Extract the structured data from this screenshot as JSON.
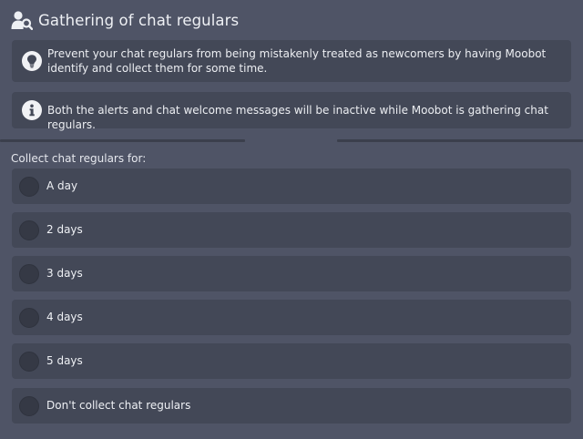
{
  "header": {
    "title": "Gathering of chat regulars",
    "icon": "user-search-icon"
  },
  "notices": {
    "tip": {
      "icon": "lightbulb-icon",
      "text": "Prevent your chat regulars from being mistakenly treated as newcomers by having Moobot identify and collect them for some time."
    },
    "info": {
      "icon": "info-icon",
      "text": "Both the alerts and chat welcome messages will be inactive while Moobot is gathering chat regulars."
    }
  },
  "collect": {
    "label": "Collect chat regulars for:",
    "options": [
      {
        "label": "A day",
        "selected": false
      },
      {
        "label": "2 days",
        "selected": false
      },
      {
        "label": "3 days",
        "selected": false
      },
      {
        "label": "4 days",
        "selected": false
      },
      {
        "label": "5 days",
        "selected": false
      },
      {
        "label": "Don't collect chat regulars",
        "selected": false
      }
    ]
  },
  "colors": {
    "background": "#4f5466",
    "card": "#434857",
    "radio": "#353945",
    "text": "#eef0f4"
  }
}
